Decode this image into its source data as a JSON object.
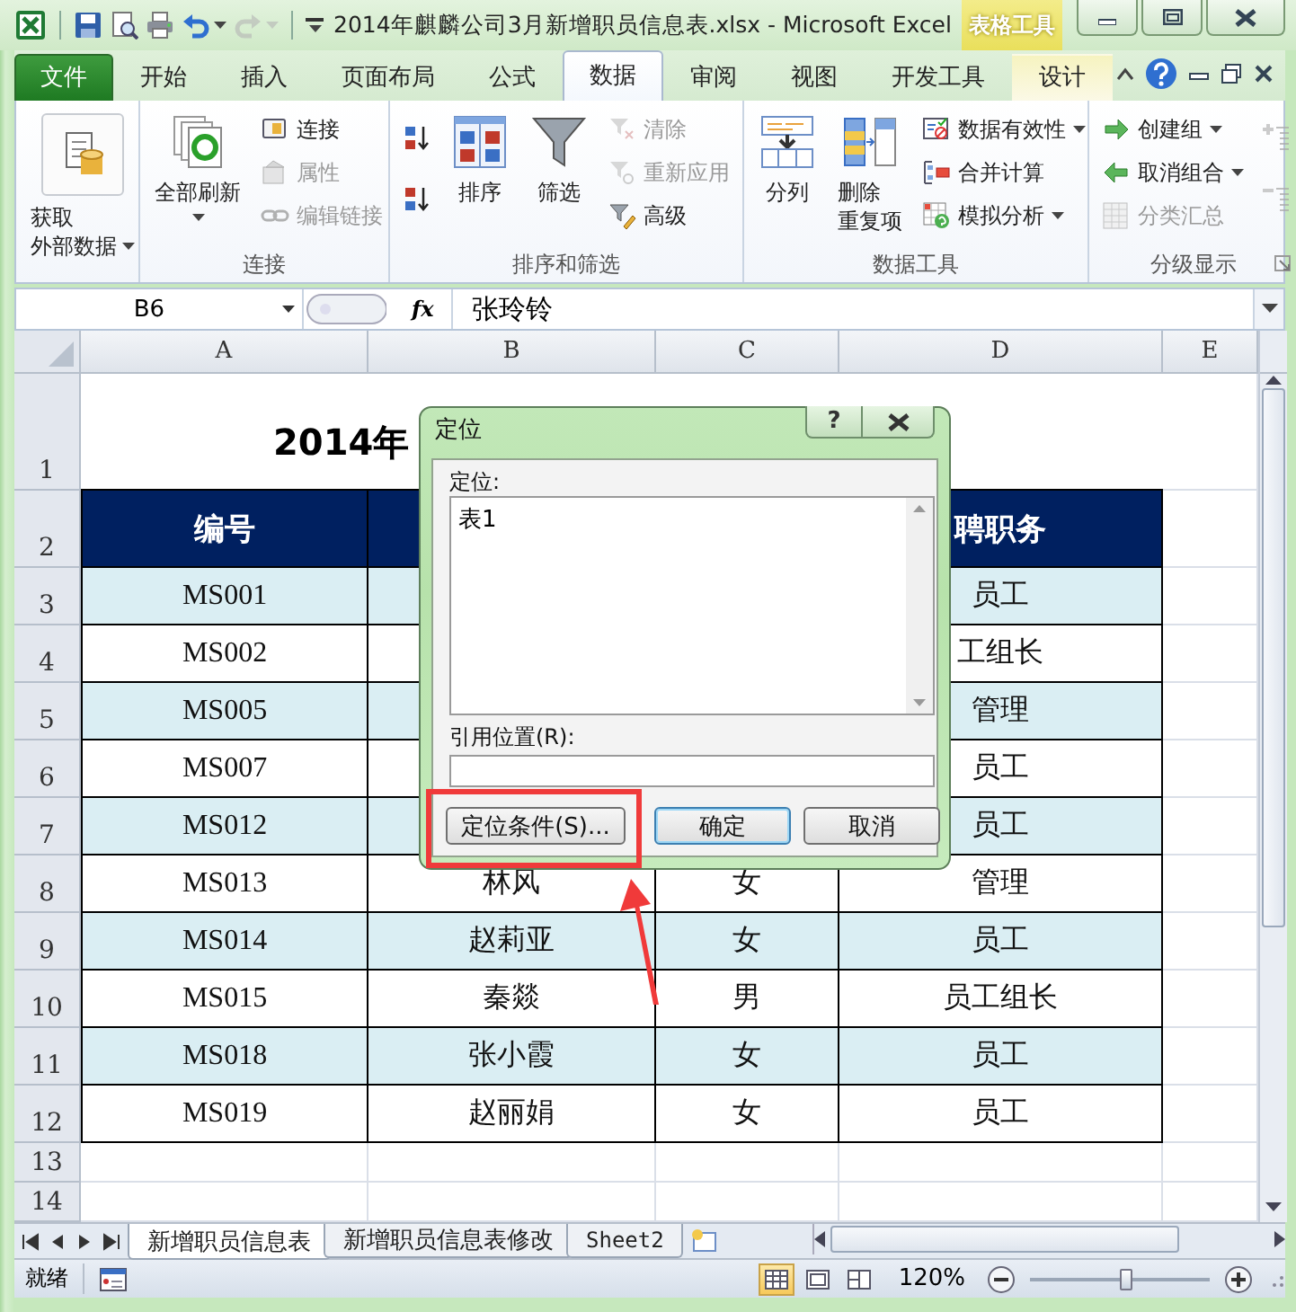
{
  "window": {
    "title": "2014年麒麟公司3月新增职员信息表.xlsx  -  Microsoft Excel",
    "context_label": "表格工具"
  },
  "quick_access": [
    {
      "kind": "save",
      "disabled": false,
      "dropdown": false
    },
    {
      "kind": "print_preview",
      "disabled": false,
      "dropdown": false
    },
    {
      "kind": "print",
      "disabled": false,
      "dropdown": false
    },
    {
      "kind": "undo",
      "disabled": false,
      "dropdown": true
    },
    {
      "kind": "redo",
      "disabled": true,
      "dropdown": true
    },
    {
      "kind": "customize",
      "disabled": false,
      "dropdown": true
    }
  ],
  "tabs": [
    {
      "label": "文件",
      "kind": "file",
      "selected": false
    },
    {
      "label": "开始",
      "kind": "normal",
      "selected": false
    },
    {
      "label": "插入",
      "kind": "normal",
      "selected": false
    },
    {
      "label": "页面布局",
      "kind": "normal",
      "selected": false
    },
    {
      "label": "公式",
      "kind": "normal",
      "selected": false
    },
    {
      "label": "数据",
      "kind": "normal",
      "selected": true
    },
    {
      "label": "审阅",
      "kind": "normal",
      "selected": false
    },
    {
      "label": "视图",
      "kind": "normal",
      "selected": false
    },
    {
      "label": "开发工具",
      "kind": "normal",
      "selected": false
    },
    {
      "label": "设计",
      "kind": "contextual",
      "selected": false
    }
  ],
  "ribbon": {
    "groups": [
      {
        "columns": [
          [
            {
              "kind": "large",
              "lines": [
                "获取",
                "外部数据"
              ],
              "dropdown": true,
              "disabled": false
            }
          ]
        ]
      },
      {
        "label": "连接",
        "columns": [
          [
            {
              "kind": "large",
              "lines": [
                "全部刷新"
              ],
              "dropdown": true,
              "disabled": false
            }
          ],
          [
            {
              "kind": "small",
              "lines": [
                "连接"
              ],
              "dropdown": false,
              "disabled": false
            },
            {
              "kind": "small",
              "lines": [
                "属性"
              ],
              "dropdown": false,
              "disabled": true
            },
            {
              "kind": "small",
              "lines": [
                "编辑链接"
              ],
              "dropdown": false,
              "disabled": true
            }
          ]
        ]
      },
      {
        "label": "排序和筛选",
        "columns": [
          [
            {
              "kind": "icon",
              "dropdown": false,
              "disabled": false
            },
            {
              "kind": "icon",
              "dropdown": false,
              "disabled": false
            }
          ],
          [
            {
              "kind": "large",
              "lines": [
                "排序"
              ],
              "dropdown": false,
              "disabled": false
            }
          ],
          [
            {
              "kind": "large",
              "lines": [
                "筛选"
              ],
              "dropdown": false,
              "disabled": false
            }
          ],
          [
            {
              "kind": "small",
              "lines": [
                "清除"
              ],
              "dropdown": false,
              "disabled": true
            },
            {
              "kind": "small",
              "lines": [
                "重新应用"
              ],
              "dropdown": false,
              "disabled": true
            },
            {
              "kind": "small",
              "lines": [
                "高级"
              ],
              "dropdown": false,
              "disabled": false
            }
          ]
        ]
      },
      {
        "label": "数据工具",
        "columns": [
          [
            {
              "kind": "large",
              "lines": [
                "分列"
              ],
              "dropdown": false,
              "disabled": false
            }
          ],
          [
            {
              "kind": "large",
              "lines": [
                "删除",
                "重复项"
              ],
              "dropdown": false,
              "disabled": false
            }
          ],
          [
            {
              "kind": "small",
              "lines": [
                "数据有效性"
              ],
              "dropdown": true,
              "disabled": false
            },
            {
              "kind": "small",
              "lines": [
                "合并计算"
              ],
              "dropdown": false,
              "disabled": false
            },
            {
              "kind": "small",
              "lines": [
                "模拟分析"
              ],
              "dropdown": true,
              "disabled": false
            }
          ]
        ]
      },
      {
        "label": "分级显示",
        "launcher": true,
        "columns": [
          [
            {
              "kind": "small",
              "lines": [
                "创建组"
              ],
              "dropdown": true,
              "disabled": false
            },
            {
              "kind": "small",
              "lines": [
                "取消组合"
              ],
              "dropdown": true,
              "disabled": false
            },
            {
              "kind": "small",
              "lines": [
                "分类汇总"
              ],
              "dropdown": false,
              "disabled": true
            }
          ],
          [
            {
              "kind": "icon",
              "dropdown": false,
              "disabled": true
            },
            {
              "kind": "icon",
              "dropdown": false,
              "disabled": true
            }
          ]
        ]
      }
    ]
  },
  "formula_bar": {
    "name_box": "B6",
    "fx": "fx",
    "value": "张玲铃"
  },
  "table": {
    "columns": [
      "A",
      "B",
      "C",
      "D",
      "E"
    ],
    "title_row": {
      "number": "1",
      "text": "2014年"
    },
    "header_row": {
      "number": "2",
      "cells": {
        "A": "编号",
        "D": "聘职务"
      }
    },
    "rows": [
      {
        "number": "3",
        "cells": {
          "A": "MS001",
          "D": "员工"
        }
      },
      {
        "number": "4",
        "cells": {
          "A": "MS002",
          "D": "工组长"
        }
      },
      {
        "number": "5",
        "cells": {
          "A": "MS005",
          "D": "管理"
        }
      },
      {
        "number": "6",
        "cells": {
          "A": "MS007",
          "D": "员工"
        }
      },
      {
        "number": "7",
        "cells": {
          "A": "MS012",
          "D": "员工"
        }
      },
      {
        "number": "8",
        "cells": {
          "A": "MS013",
          "B": "林风",
          "C": "女",
          "D": "管理"
        }
      },
      {
        "number": "9",
        "cells": {
          "A": "MS014",
          "B": "赵莉亚",
          "C": "女",
          "D": "员工"
        }
      },
      {
        "number": "10",
        "cells": {
          "A": "MS015",
          "B": "秦燚",
          "C": "男",
          "D": "员工组长"
        }
      },
      {
        "number": "11",
        "cells": {
          "A": "MS018",
          "B": "张小霞",
          "C": "女",
          "D": "员工"
        }
      },
      {
        "number": "12",
        "cells": {
          "A": "MS019",
          "B": "赵丽娟",
          "C": "女",
          "D": "员工"
        }
      }
    ],
    "empty_rows": [
      "13",
      "14"
    ]
  },
  "dialog": {
    "title": "定位",
    "help": "?",
    "list_label": "定位:",
    "list_items": [
      "表1"
    ],
    "ref_label": "引用位置(R):",
    "buttons": [
      {
        "label": "定位条件(S)...",
        "default": false,
        "highlighted": true
      },
      {
        "label": "确定",
        "default": true,
        "highlighted": false
      },
      {
        "label": "取消",
        "default": false,
        "highlighted": false
      }
    ]
  },
  "sheet_tabs": [
    {
      "label": "新增职员信息表",
      "selected": true
    },
    {
      "label": "新增职员信息表修改",
      "selected": false
    },
    {
      "label": "Sheet2",
      "selected": false
    }
  ],
  "status_bar": {
    "ready": "就绪",
    "view_modes": [
      {
        "selected": true
      },
      {
        "selected": false
      },
      {
        "selected": false
      }
    ],
    "zoom": "120%",
    "zoom_slider": {
      "level": 0.53
    }
  }
}
